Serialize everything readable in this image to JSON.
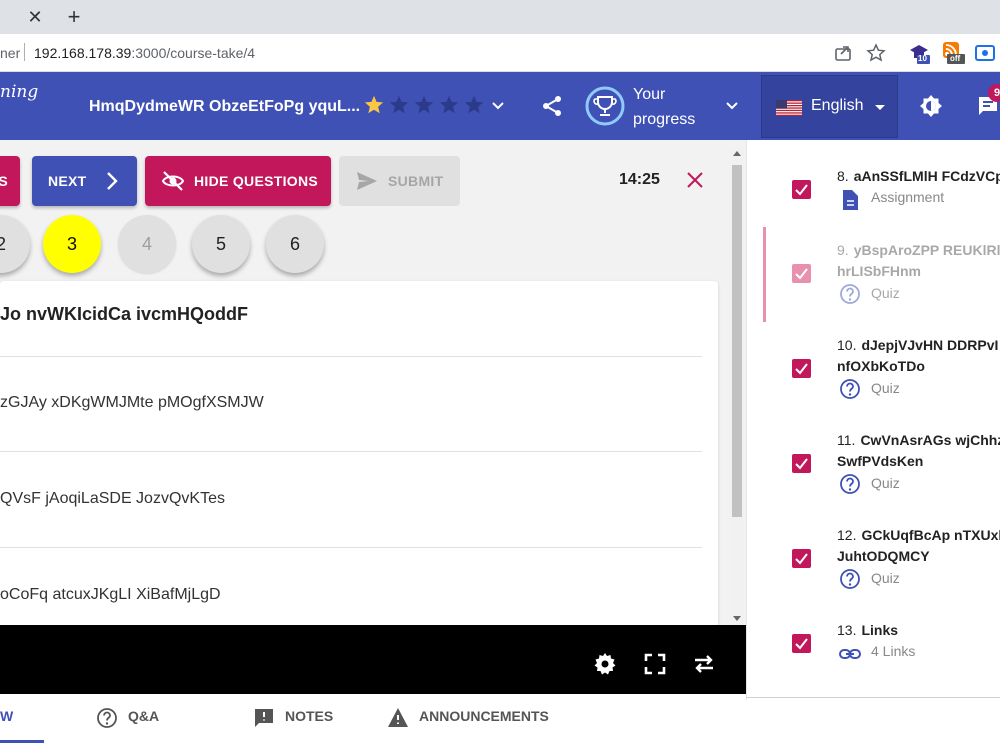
{
  "browser": {
    "url_prefix": "ner",
    "url_host": "192.168.178.39",
    "url_path": ":3000/course-take/4",
    "ext_badge_1": "10",
    "ext_badge_2": "off"
  },
  "header": {
    "brand": "ning",
    "course_title": "HmqDydmeWR ObzeEtFoPg yquL...",
    "rating": {
      "filled": 1,
      "total": 5
    },
    "progress_label_line1": "Your",
    "progress_label_line2": "progress",
    "language": "English",
    "notification_count": "9",
    "colors": {
      "primary": "#3f51b5",
      "accent": "#c2185b"
    }
  },
  "quiz": {
    "prev_label": "S",
    "next_label": "NEXT",
    "hide_label": "HIDE QUESTIONS",
    "submit_label": "SUBMIT",
    "timer": "14:25",
    "question_numbers": [
      "2",
      "3",
      "4",
      "5",
      "6"
    ],
    "active_question": "3",
    "question_title": "Jo nvWKIcidCa ivcmHQoddF",
    "answers": [
      "zGJAy xDKgWMJMte pMOgfXSMJW",
      "QVsF jAoqiLaSDE JozvQvKTes",
      "oCoFq atcuxJKgLI XiBafMjLgD"
    ]
  },
  "bottom_tabs": [
    {
      "label": "W",
      "icon": "overview-icon"
    },
    {
      "label": "Q&A",
      "icon": "help-circle-icon"
    },
    {
      "label": "NOTES",
      "icon": "note-icon"
    },
    {
      "label": "ANNOUNCEMENTS",
      "icon": "warning-icon"
    }
  ],
  "sidebar": {
    "items": [
      {
        "num": "8.",
        "title_line1": "aAnSSfLMlH FCdzVCp",
        "title_line2": "",
        "type": "Assignment",
        "icon": "document-icon"
      },
      {
        "num": "9.",
        "title_line1": "yBspAroZPP REUKlRl",
        "title_line2": "hrLISbFHnm",
        "type": "Quiz",
        "icon": "help-circle-icon"
      },
      {
        "num": "10.",
        "title_line1": "dJepjVJvHN DDRPvI",
        "title_line2": "nfOXbKoTDo",
        "type": "Quiz",
        "icon": "help-circle-icon"
      },
      {
        "num": "11.",
        "title_line1": "CwVnAsrAGs wjChhz",
        "title_line2": "SwfPVdsKen",
        "type": "Quiz",
        "icon": "help-circle-icon"
      },
      {
        "num": "12.",
        "title_line1": "GCkUqfBcAp nTXUxl",
        "title_line2": "JuhtODQMCY",
        "type": "Quiz",
        "icon": "help-circle-icon"
      },
      {
        "num": "13.",
        "title_line1": "Links",
        "title_line2": "",
        "type": "4  Links",
        "icon": "link-icon"
      }
    ]
  }
}
